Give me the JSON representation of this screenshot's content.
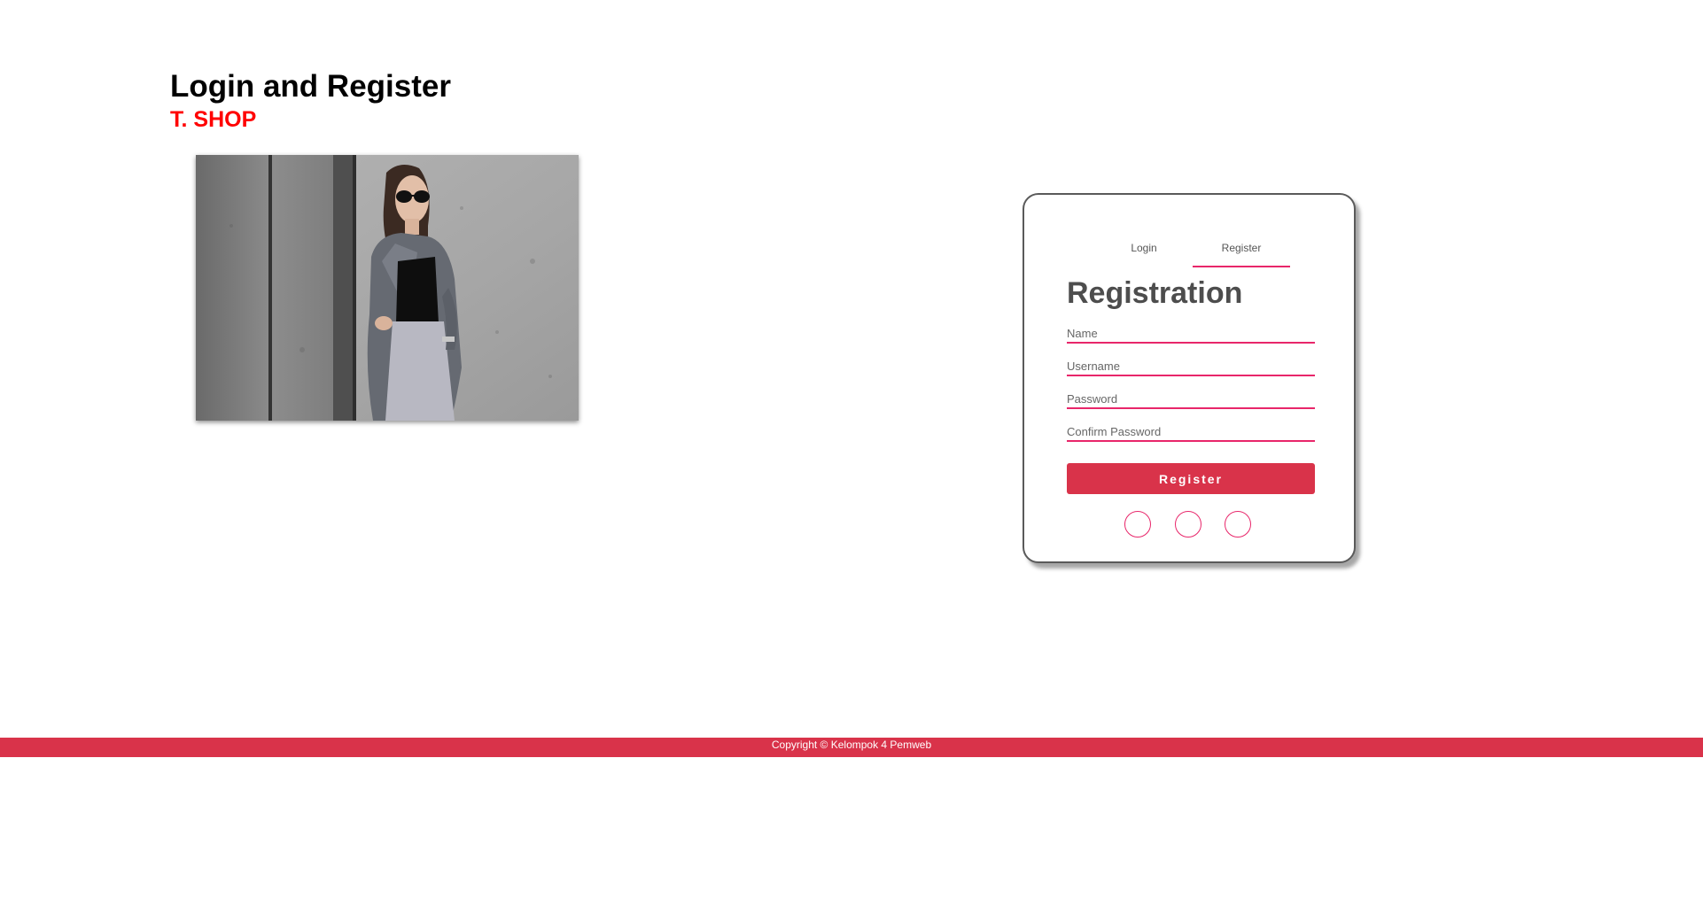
{
  "header": {
    "title": "Login and Register",
    "subtitle": "T. SHOP"
  },
  "hero": {
    "image": "fashion-model-photo"
  },
  "auth_card": {
    "tabs": [
      {
        "label": "Login",
        "active": false
      },
      {
        "label": "Register",
        "active": true
      }
    ],
    "form_title": "Registration",
    "fields": [
      {
        "placeholder": "Name",
        "value": ""
      },
      {
        "placeholder": "Username",
        "value": ""
      },
      {
        "placeholder": "Password",
        "value": ""
      },
      {
        "placeholder": "Confirm Password",
        "value": ""
      }
    ],
    "submit_label": "Register",
    "social_buttons": [
      "social-icon",
      "social-icon",
      "social-icon"
    ]
  },
  "footer": {
    "text": "Copyright © Kelompok 4 Pemweb"
  },
  "colors": {
    "accent": "#d9334a",
    "underline": "#e8266a",
    "subtitle": "#ff0000"
  }
}
